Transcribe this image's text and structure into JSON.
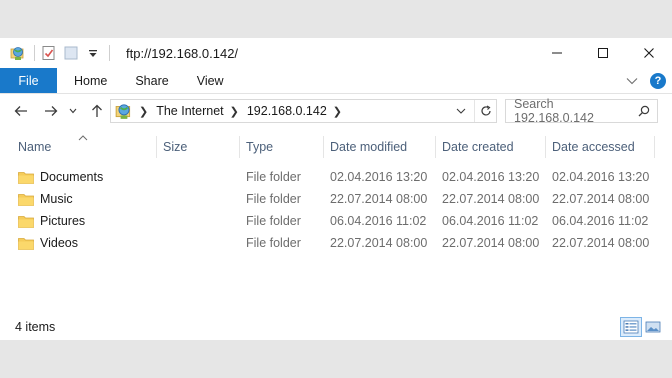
{
  "window": {
    "title": "ftp://192.168.0.142/"
  },
  "ribbon": {
    "tabs": [
      {
        "label": "File"
      },
      {
        "label": "Home"
      },
      {
        "label": "Share"
      },
      {
        "label": "View"
      }
    ]
  },
  "address": {
    "crumbs": [
      "The Internet",
      "192.168.0.142"
    ]
  },
  "search": {
    "placeholder": "Search 192.168.0.142"
  },
  "columns": [
    "Name",
    "Size",
    "Type",
    "Date modified",
    "Date created",
    "Date accessed"
  ],
  "files": [
    {
      "name": "Documents",
      "size": "",
      "type": "File folder",
      "modified": "02.04.2016 13:20",
      "created": "02.04.2016 13:20",
      "accessed": "02.04.2016 13:20"
    },
    {
      "name": "Music",
      "size": "",
      "type": "File folder",
      "modified": "22.07.2014 08:00",
      "created": "22.07.2014 08:00",
      "accessed": "22.07.2014 08:00"
    },
    {
      "name": "Pictures",
      "size": "",
      "type": "File folder",
      "modified": "06.04.2016 11:02",
      "created": "06.04.2016 11:02",
      "accessed": "06.04.2016 11:02"
    },
    {
      "name": "Videos",
      "size": "",
      "type": "File folder",
      "modified": "22.07.2014 08:00",
      "created": "22.07.2014 08:00",
      "accessed": "22.07.2014 08:00"
    }
  ],
  "status": {
    "item_count": "4 items"
  },
  "colors": {
    "accent": "#1979ca",
    "header_text": "#4c607a",
    "folder": "#f5cc5a"
  },
  "icons": {
    "app": "network-globe-icon",
    "properties": "properties-check-icon",
    "new_folder": "new-folder-icon",
    "customize": "chevron-down-icon"
  }
}
